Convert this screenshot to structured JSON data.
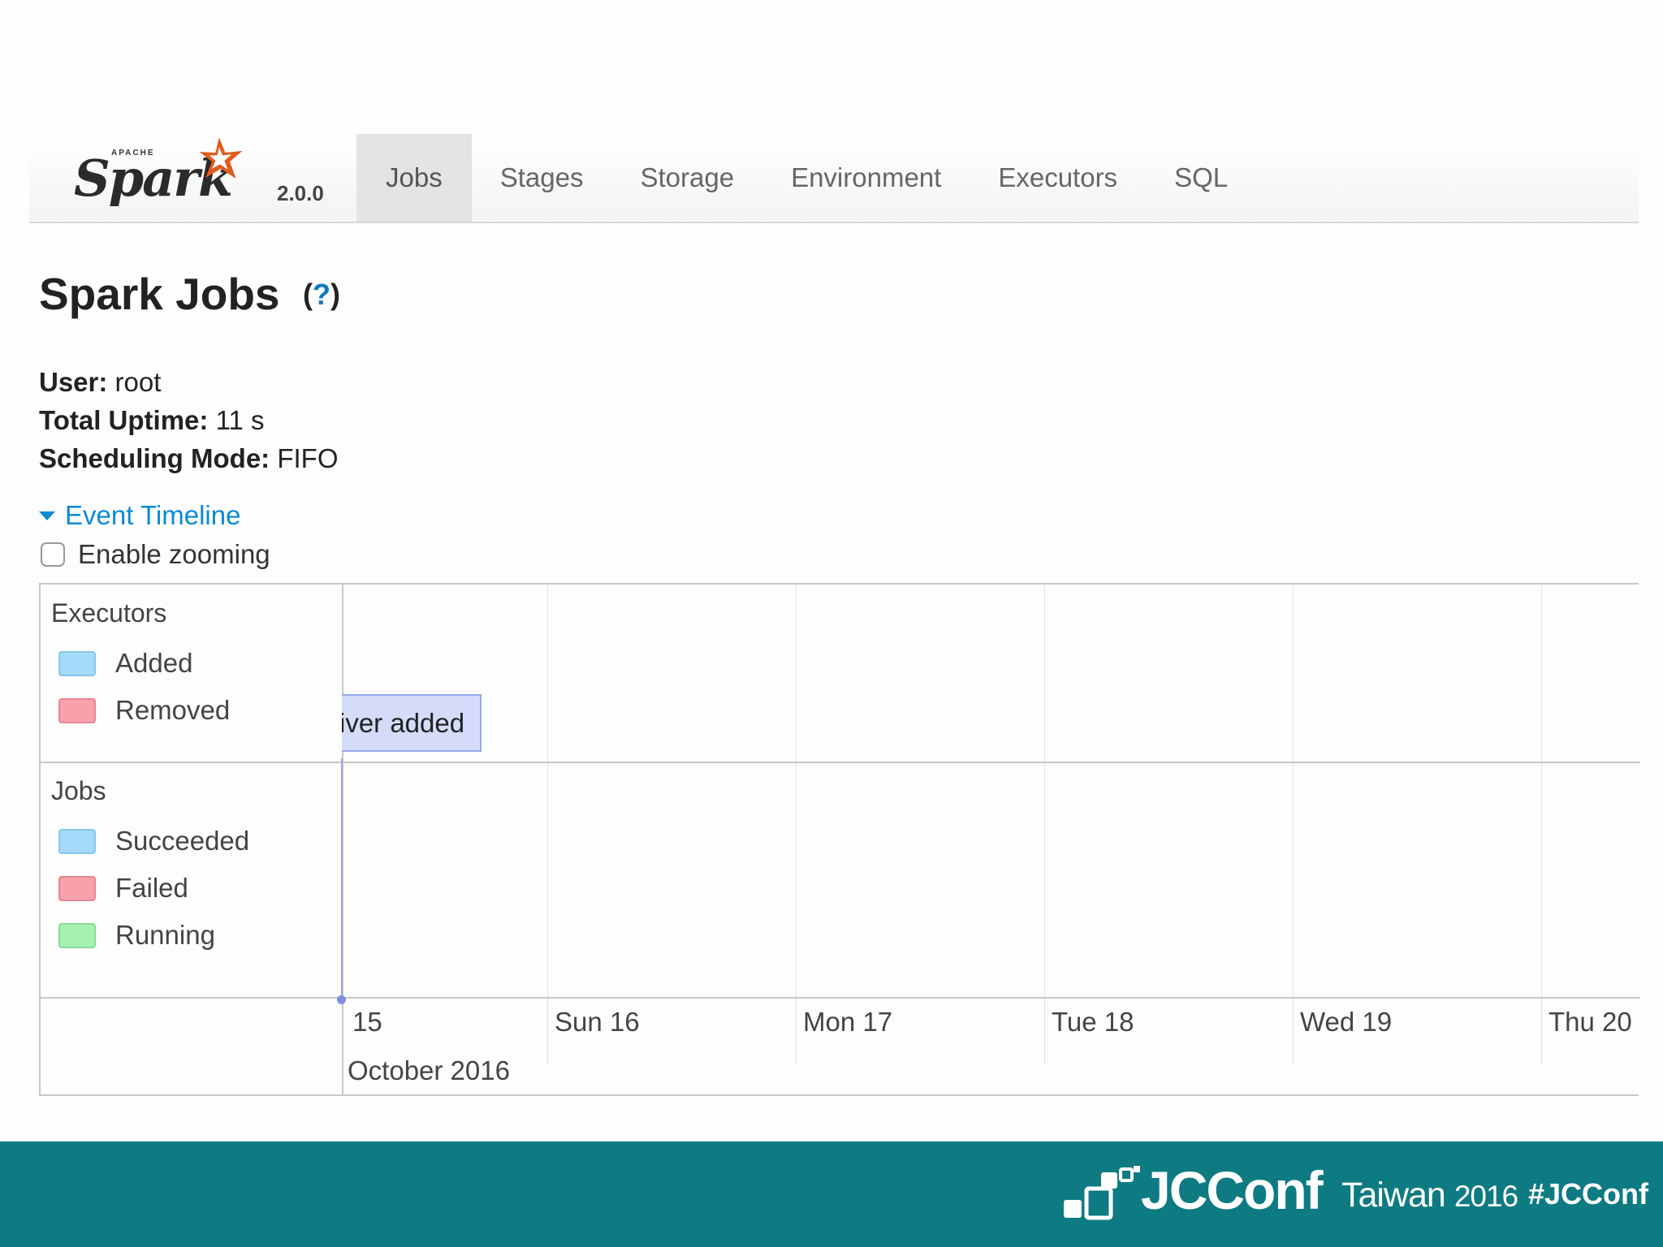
{
  "brand": {
    "apache": "APACHE",
    "name": "Spark",
    "version": "2.0.0"
  },
  "nav": {
    "tabs": [
      "Jobs",
      "Stages",
      "Storage",
      "Environment",
      "Executors",
      "SQL"
    ],
    "active": "Jobs"
  },
  "page": {
    "title": "Spark Jobs",
    "help_open": "(",
    "help_q": "?",
    "help_close": ")",
    "user_label": "User:",
    "user_value": "root",
    "uptime_label": "Total Uptime:",
    "uptime_value": "11 s",
    "sched_label": "Scheduling Mode:",
    "sched_value": "FIFO"
  },
  "timeline": {
    "toggle_label": "Event Timeline",
    "zoom_label": "Enable zooming",
    "executors_group": "Executors",
    "executors_legend": [
      "Added",
      "Removed"
    ],
    "jobs_group": "Jobs",
    "jobs_legend": [
      "Succeeded",
      "Failed",
      "Running"
    ],
    "event_text": "river added",
    "axis_labels": [
      "15",
      "Sun 16",
      "Mon 17",
      "Tue 18",
      "Wed 19",
      "Thu 20"
    ],
    "month_label": "October 2016"
  },
  "footer": {
    "logo_text": "JCConf",
    "region": "Taiwan",
    "year": "2016",
    "hashtag": "#JCConf"
  },
  "colors": {
    "accent_link": "#0c8ad4",
    "added_succeeded": "#a4dbf8",
    "removed_failed": "#f7a1ad",
    "running": "#a6f1b2",
    "footer_bg": "#0e7b82",
    "spark_star": "#e25a1c"
  }
}
